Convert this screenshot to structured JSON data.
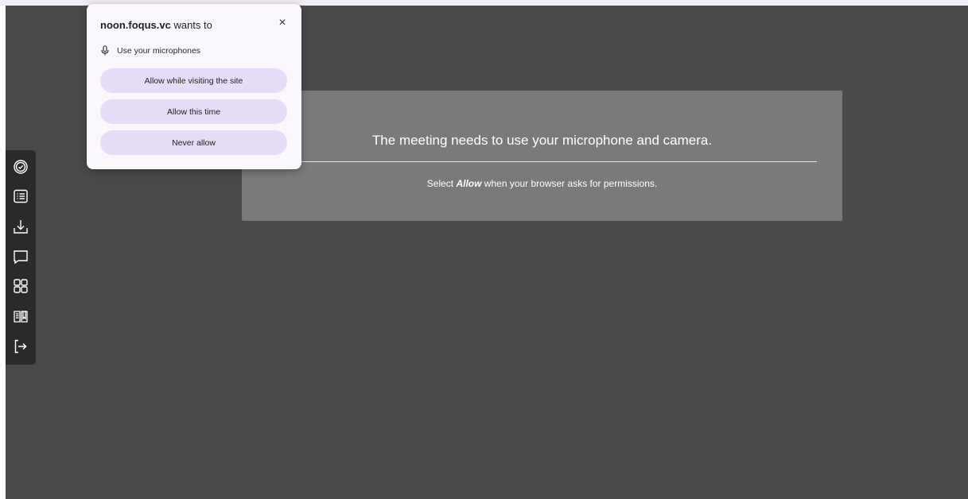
{
  "popup": {
    "site": "noon.foqus.vc",
    "wants_to": " wants to",
    "close_glyph": "×",
    "permission": "Use your microphones",
    "buttons": {
      "allow_visiting": "Allow while visiting the site",
      "allow_once": "Allow this time",
      "never": "Never allow"
    }
  },
  "panel": {
    "title": "The meeting needs to use your microphone and camera.",
    "sub_prefix": "Select ",
    "sub_emphasis": "Allow",
    "sub_suffix": " when your browser asks for permissions."
  },
  "toolbar": {
    "items": [
      {
        "icon": "check-circle-icon"
      },
      {
        "icon": "list-icon"
      },
      {
        "icon": "download-icon"
      },
      {
        "icon": "chat-icon"
      },
      {
        "icon": "grid-icon"
      },
      {
        "icon": "book-icon"
      },
      {
        "icon": "exit-icon"
      }
    ]
  },
  "colors": {
    "stage": "#4a4a4a",
    "panel": "#7a7a7a",
    "toolbar": "#2a2a2a",
    "popup_bg": "#fbf8fd",
    "popup_button": "#e7dcf8"
  }
}
